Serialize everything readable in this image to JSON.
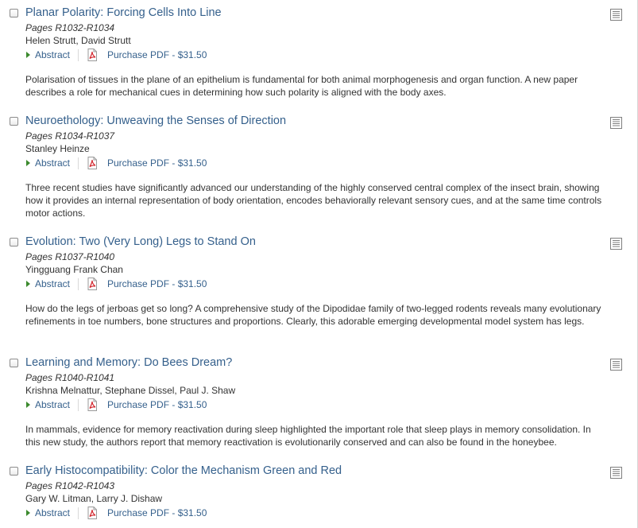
{
  "articles": [
    {
      "title": "Planar Polarity: Forcing Cells Into Line",
      "pages": "Pages R1032-R1034",
      "authors": "Helen Strutt, David Strutt",
      "abstract_label": "Abstract",
      "pdf_label": "Purchase PDF - $31.50",
      "summary": "Polarisation of tissues in the plane of an epithelium is fundamental for both animal morphogenesis and organ function. A new paper describes a role for mechanical cues in determining how such polarity is aligned with the body axes."
    },
    {
      "title": "Neuroethology: Unweaving the Senses of Direction",
      "pages": "Pages R1034-R1037",
      "authors": "Stanley Heinze",
      "abstract_label": "Abstract",
      "pdf_label": "Purchase PDF - $31.50",
      "summary": "Three recent studies have significantly advanced our understanding of the highly conserved central complex of the insect brain, showing how it provides an internal representation of body orientation, encodes behaviorally relevant sensory cues, and at the same time controls motor actions."
    },
    {
      "title": "Evolution: Two (Very Long) Legs to Stand On",
      "pages": "Pages R1037-R1040",
      "authors": "Yingguang Frank Chan",
      "abstract_label": "Abstract",
      "pdf_label": "Purchase PDF - $31.50",
      "summary": "How do the legs of jerboas get so long? A comprehensive study of the Dipodidae family of two-legged rodents reveals many evolutionary refinements in toe numbers, bone structures and proportions. Clearly, this adorable emerging developmental model system has legs."
    },
    {
      "title": "Learning and Memory: Do Bees Dream?",
      "pages": "Pages R1040-R1041",
      "authors": "Krishna Melnattur, Stephane Dissel, Paul J. Shaw",
      "abstract_label": "Abstract",
      "pdf_label": "Purchase PDF - $31.50",
      "summary": "In mammals, evidence for memory reactivation during sleep highlighted the important role that sleep plays in memory consolidation. In this new study, the authors report that memory reactivation is evolutionarily conserved and can also be found in the honeybee."
    },
    {
      "title": "Early Histocompatibility: Color the Mechanism Green and Red",
      "pages": "Pages R1042-R1043",
      "authors": "Gary W. Litman, Larry J. Dishaw",
      "abstract_label": "Abstract",
      "pdf_label": "Purchase PDF - $31.50",
      "summary": ""
    }
  ],
  "colors": {
    "link": "#35608c",
    "text": "#333333",
    "expand_arrow": "#3c8a2e",
    "pdf_icon": "#d2232a"
  },
  "icons": {
    "select": "checkbox",
    "expand": "triangle-right-icon",
    "pdf": "pdf-file-icon",
    "toc": "table-of-contents-icon"
  }
}
